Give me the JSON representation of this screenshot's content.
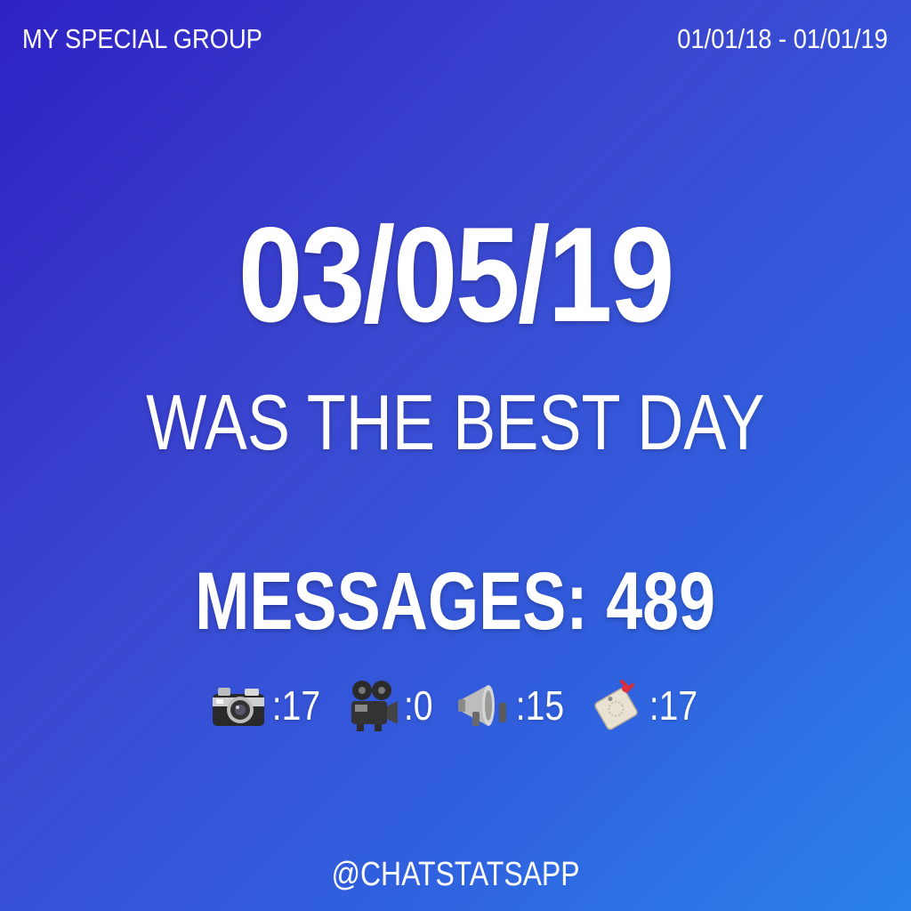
{
  "header": {
    "group_name": "MY SPECIAL GROUP",
    "date_range": "01/01/18 - 01/01/19"
  },
  "main": {
    "best_date": "03/05/19",
    "subtitle": "WAS THE BEST DAY",
    "messages_label": "MESSAGES: 489"
  },
  "stats": [
    {
      "icon": "camera-icon",
      "count": ":17"
    },
    {
      "icon": "movie-camera-icon",
      "count": ":0"
    },
    {
      "icon": "megaphone-icon",
      "count": ":15"
    },
    {
      "icon": "sticker-tag-icon",
      "count": ":17"
    }
  ],
  "footer": {
    "handle": "@CHATSTATSAPP"
  }
}
